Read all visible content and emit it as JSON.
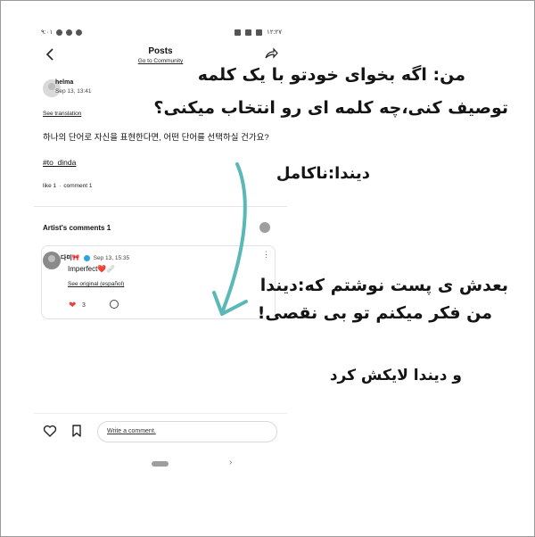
{
  "status_bar": {
    "left_text": "۹:۰۱",
    "right_text": "۱۲:۲۷"
  },
  "header": {
    "title": "Posts",
    "subtitle": "Go to Community"
  },
  "post": {
    "author": "helma",
    "date": "Sep 13, 13:41",
    "see_translation": "See translation",
    "text": "하나의 단어로 자신을 표현한다면, 어떤 단어를 선택하실 건가요?",
    "hashtag": "#to_dinda",
    "like_label": "like 1",
    "separator": "·",
    "comment_label": "comment 1"
  },
  "artist_comments": {
    "heading": "Artist's comments 1",
    "comment": {
      "name": "다미🎀",
      "date": "Sep 13, 15:35",
      "text": "Imperfect❤️🩹",
      "see_original": "See original (español)",
      "likes": "3"
    }
  },
  "bottom_bar": {
    "write_placeholder": "Write a comment."
  },
  "overlay": {
    "line1": "من: اگه بخوای خودتو با یک کلمه",
    "line2": "توصیف کنی،چه کلمه ای رو انتخاب میکنی؟",
    "line3": "دیندا:ناکامل",
    "line4": "بعدش ی پست نوشتم که:دیندا",
    "line5": "من فکر میکنم تو بی نقصی!",
    "line6": "و دیندا لایکش کرد"
  },
  "colors": {
    "heart": "#e04848",
    "verified": "#2aa5e0",
    "arrow": "#5ab9b6"
  },
  "icons": [
    "back-arrow-icon",
    "share-icon",
    "heart-icon",
    "bookmark-icon",
    "reply-icon",
    "more-icon",
    "verified-icon"
  ]
}
